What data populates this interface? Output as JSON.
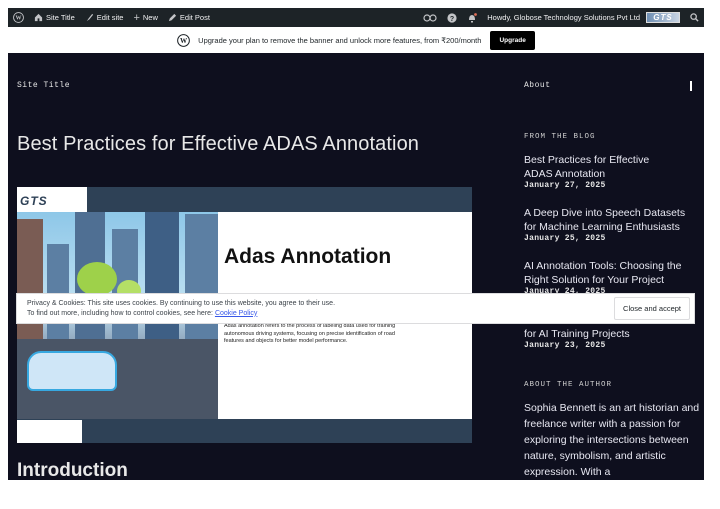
{
  "adminbar": {
    "site_title": "Site Title",
    "edit_site": "Edit site",
    "new": "New",
    "edit_post": "Edit Post",
    "greeting": "Howdy, Globose Technology Solutions Pvt Ltd",
    "avatar_text": "GTS"
  },
  "upgrade_banner": {
    "message": "Upgrade your plan to remove the banner and unlock more features, from ₹200/month",
    "button": "Upgrade"
  },
  "header": {
    "site_title": "Site Title",
    "nav_about": "About"
  },
  "post": {
    "title": "Best Practices for Effective ADAS Annotation",
    "intro_heading": "Introduction"
  },
  "feature_image": {
    "logo": "GTS",
    "heading": "Adas Annotation",
    "description": "Adas annotation refers to the process of labeling data used for training autonomous driving systems, focusing on precise identification of road features and objects for better model performance."
  },
  "sidebar": {
    "blog_heading": "FROM THE BLOG",
    "items": [
      {
        "title": "Best Practices for Effective ADAS Annotation",
        "date": "January 27, 2025"
      },
      {
        "title": "A Deep Dive into Speech Datasets for Machine Learning Enthusiasts",
        "date": "January 25, 2025"
      },
      {
        "title": "AI Annotation Tools: Choosing the Right Solution for Your Project",
        "date": "January 24, 2025"
      },
      {
        "title": "for AI Training Projects",
        "date": "January 23, 2025"
      }
    ],
    "author_heading": "ABOUT THE AUTHOR",
    "author_bio": "Sophia Bennett is an art historian and freelance writer with a passion for exploring the intersections between nature, symbolism, and artistic expression. With a"
  },
  "cookie_banner": {
    "line1": "Privacy & Cookies: This site uses cookies. By continuing to use this website, you agree to their use.",
    "line2_prefix": "To find out more, including how to control cookies, see here: ",
    "policy_link": "Cookie Policy",
    "accept_button": "Close and accept"
  }
}
